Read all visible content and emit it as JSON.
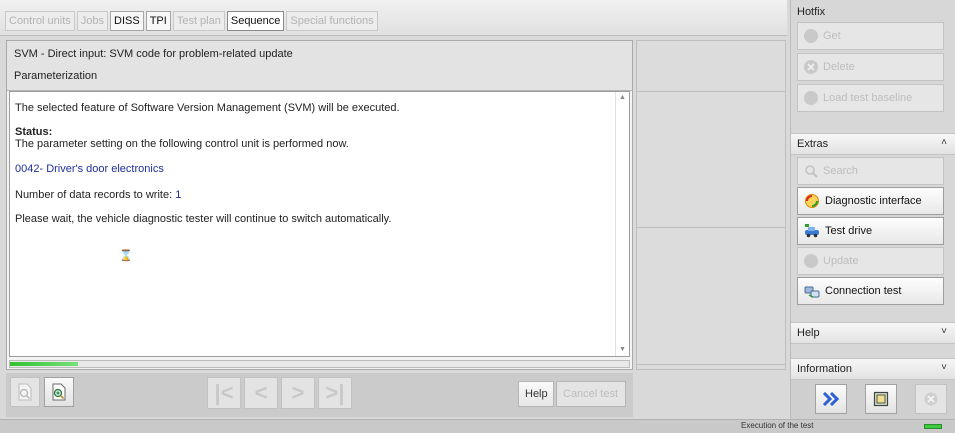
{
  "tabs": [
    {
      "label": "Control units",
      "state": "disabled"
    },
    {
      "label": "Jobs",
      "state": "disabled"
    },
    {
      "label": "DISS",
      "state": "enabled"
    },
    {
      "label": "TPI",
      "state": "enabled"
    },
    {
      "label": "Test plan",
      "state": "disabled"
    },
    {
      "label": "Sequence",
      "state": "active"
    },
    {
      "label": "Special functions",
      "state": "disabled"
    }
  ],
  "main": {
    "title": "SVM - Direct input: SVM code for problem-related update",
    "subtitle": "Parameterization",
    "content": {
      "intro": "The selected feature of Software Version Management (SVM) will be executed.",
      "status_label": "Status:",
      "status_text": "The parameter setting on the following control unit is performed now.",
      "control_unit": "0042- Driver's door electronics",
      "records_label": "Number of data records to write: ",
      "records_count": "1",
      "wait_text": "Please wait, the vehicle diagnostic tester will continue to switch automatically."
    },
    "progress_fraction": 0.11
  },
  "toolbar": {
    "help_label": "Help",
    "cancel_label": "Cancel test"
  },
  "sidebar": {
    "hotfix": {
      "title": "Hotfix",
      "buttons": [
        {
          "label": "Get",
          "enabled": false
        },
        {
          "label": "Delete",
          "enabled": false
        },
        {
          "label": "Load test baseline",
          "enabled": false
        }
      ]
    },
    "extras": {
      "title": "Extras",
      "buttons": [
        {
          "label": "Search",
          "enabled": false
        },
        {
          "label": "Diagnostic interface",
          "enabled": true
        },
        {
          "label": "Test drive",
          "enabled": true
        },
        {
          "label": "Update",
          "enabled": false
        },
        {
          "label": "Connection test",
          "enabled": true
        }
      ]
    },
    "help_label": "Help",
    "information_label": "Information"
  },
  "statusbar": {
    "text": "Execution of the test"
  },
  "colors": {
    "link_blue": "#1d2f9a",
    "progress_green": "#2fc32f",
    "accent_blue": "#2d5fd6"
  }
}
